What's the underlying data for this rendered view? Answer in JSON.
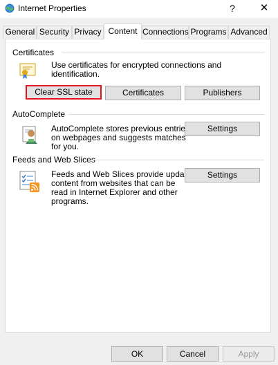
{
  "window": {
    "title": "Internet Properties",
    "help_label": "?",
    "close_label": "✕"
  },
  "tabs": [
    {
      "label": "General"
    },
    {
      "label": "Security"
    },
    {
      "label": "Privacy"
    },
    {
      "label": "Content",
      "active": true
    },
    {
      "label": "Connections"
    },
    {
      "label": "Programs"
    },
    {
      "label": "Advanced"
    }
  ],
  "certificates": {
    "heading": "Certificates",
    "description": "Use certificates for encrypted connections and identification.",
    "clear_ssl_label": "Clear SSL state",
    "certificates_label": "Certificates",
    "publishers_label": "Publishers"
  },
  "autocomplete": {
    "heading": "AutoComplete",
    "description_lines": [
      "AutoComplete stores previous entries",
      "on webpages and suggests matches",
      "for you."
    ],
    "settings_label": "Settings"
  },
  "feeds": {
    "heading": "Feeds and Web Slices",
    "description_lines": [
      "Feeds and Web Slices provide updated",
      "content from websites that can be",
      "read in Internet Explorer and other",
      "programs."
    ],
    "settings_label": "Settings"
  },
  "footer": {
    "ok_label": "OK",
    "cancel_label": "Cancel",
    "apply_label": "Apply"
  },
  "colors": {
    "highlight": "#e3141e",
    "rss": "#f7941e"
  },
  "icons": {
    "app": "globe-icon",
    "certificates": "certificate-icon",
    "autocomplete": "autocomplete-user-icon",
    "feeds": "feed-icon"
  }
}
